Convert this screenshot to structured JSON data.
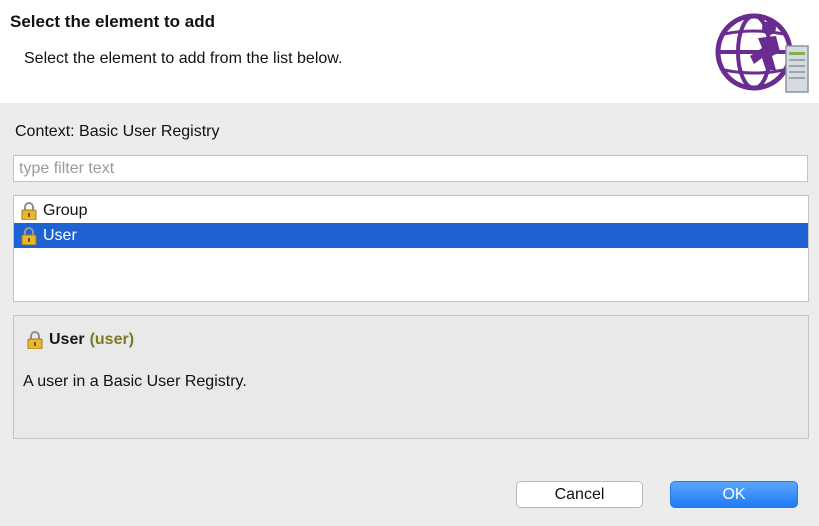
{
  "header": {
    "title": "Select the element to add",
    "subtitle": "Select the element to add from the list below."
  },
  "context": {
    "label": "Context: Basic User Registry"
  },
  "filter": {
    "value": "",
    "placeholder": "type filter text"
  },
  "list": {
    "items": [
      {
        "label": "Group",
        "icon": "lock-icon",
        "selected": false
      },
      {
        "label": "User",
        "icon": "lock-icon",
        "selected": true
      }
    ]
  },
  "details": {
    "name": "User",
    "id": "(user)",
    "description": "A user in a Basic User Registry."
  },
  "buttons": {
    "cancel": "Cancel",
    "ok": "OK"
  },
  "colors": {
    "selection": "#1f63d2",
    "ok_button": "#2a86fa",
    "id_text": "#7d7a21",
    "banner_purple": "#6a2c91"
  }
}
